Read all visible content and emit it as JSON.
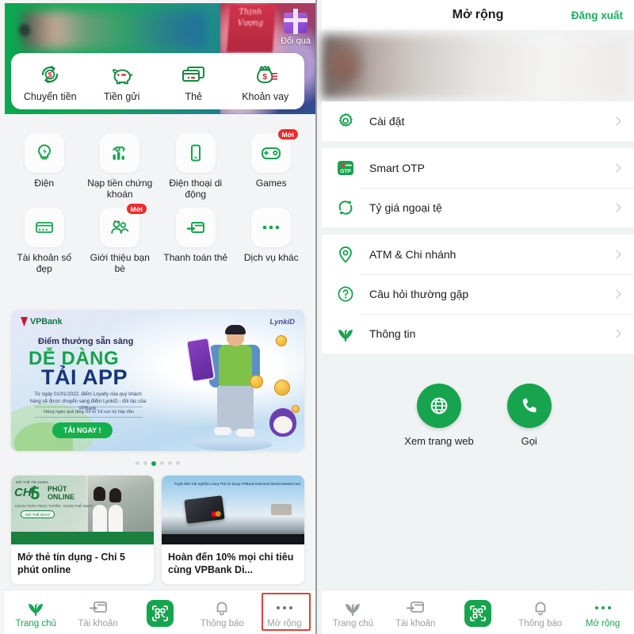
{
  "left_screen": {
    "hero": {
      "gift_label": "Đổi quà",
      "ribbon_text": "Thịnh Vượng"
    },
    "quick_actions": [
      {
        "label": "Chuyển tiền",
        "icon": "money-transfer-icon"
      },
      {
        "label": "Tiền gửi",
        "icon": "piggy-bank-icon"
      },
      {
        "label": "Thẻ",
        "icon": "credit-card-icon"
      },
      {
        "label": "Khoản vay",
        "icon": "loan-money-bag-icon"
      }
    ],
    "services": [
      {
        "label": "Điện",
        "icon": "lightbulb-icon",
        "badge": ""
      },
      {
        "label": "Nạp tiền chứng khoán",
        "icon": "stock-chart-icon",
        "badge": ""
      },
      {
        "label": "Điện thoại di động",
        "icon": "mobile-phone-icon",
        "badge": ""
      },
      {
        "label": "Games",
        "icon": "gamepad-icon",
        "badge": "Mới"
      },
      {
        "label": "Tài khoản số đẹp",
        "icon": "vip-account-card-icon",
        "badge": ""
      },
      {
        "label": "Giới thiệu bạn bè",
        "icon": "refer-friends-icon",
        "badge": "Mới"
      },
      {
        "label": "Thanh toán thẻ",
        "icon": "card-payment-icon",
        "badge": ""
      },
      {
        "label": "Dịch vụ khác",
        "icon": "more-dots-icon",
        "badge": ""
      }
    ],
    "banner": {
      "brand": "VPBank",
      "partner": "LynkiD",
      "line1": "Điểm thưởng sẵn sàng",
      "line2": "DỄ DÀNG",
      "line3": "TẢI APP",
      "paragraph": "Từ ngày 01/01/2022, điểm Loyalty của quý khách hàng sẽ được chuyển sang điểm LynkiD - đối tác của VPBank.",
      "subnote": "Hàng ngàn quà tặng chỉ từ 1đ cực kỳ hấp dẫn",
      "cta": "TẢI NGAY !",
      "dots_total": 6,
      "dots_active_index": 2
    },
    "news_cards": [
      {
        "title": "Mở thẻ tín dụng - Chỉ 5 phút online",
        "image_text_small": "MỞ THẺ TÍN DỤNG",
        "image_text_chi": "CHỈ",
        "image_text_num": "5",
        "image_text_phut": "PHÚT",
        "image_text_online": "ONLINE",
        "image_text_sub": "HOÀN TOÀN TRỰC TUYẾN - NHẬN THẺ NGAY",
        "image_btn": "MỞ THẺ NGAY"
      },
      {
        "title": "Hoàn đến 10% mọi chi tiêu cùng VPBank Di...",
        "image_text_top": "Tuyệt đỉnh trải nghiệm cùng Thẻ tín dụng VPBank Diamond World MasterCard"
      }
    ],
    "bottom_nav": [
      {
        "label": "Trang chủ",
        "icon": "home-sprout-icon",
        "active": true,
        "highlighted": false
      },
      {
        "label": "Tài khoản",
        "icon": "account-card-icon",
        "active": false,
        "highlighted": false
      },
      {
        "label": "",
        "icon": "qr-scan-icon",
        "active": false,
        "highlighted": false
      },
      {
        "label": "Thông báo",
        "icon": "bell-icon",
        "active": false,
        "highlighted": false
      },
      {
        "label": "Mở rộng",
        "icon": "more-dots-icon",
        "active": false,
        "highlighted": true
      }
    ]
  },
  "right_screen": {
    "header": {
      "title": "Mở rộng",
      "logout": "Đăng xuất"
    },
    "menu_groups": [
      {
        "items": [
          {
            "label": "Cài đặt",
            "icon": "gear-icon",
            "highlighted": true
          }
        ]
      },
      {
        "items": [
          {
            "label": "Smart OTP",
            "icon": "smart-otp-icon",
            "highlighted": false
          },
          {
            "label": "Tỷ giá ngoại tệ",
            "icon": "exchange-rate-icon",
            "highlighted": false
          }
        ]
      },
      {
        "items": [
          {
            "label": "ATM & Chi nhánh",
            "icon": "location-pin-icon",
            "highlighted": false
          },
          {
            "label": "Câu hỏi thường gặp",
            "icon": "question-mark-icon",
            "highlighted": false
          },
          {
            "label": "Thông tin",
            "icon": "info-sprout-icon",
            "highlighted": false
          }
        ]
      }
    ],
    "actions": [
      {
        "label": "Xem trang web",
        "icon": "globe-icon"
      },
      {
        "label": "Gọi",
        "icon": "phone-icon"
      }
    ],
    "bottom_nav": [
      {
        "label": "Trang chủ",
        "icon": "home-sprout-icon",
        "active": false
      },
      {
        "label": "Tài khoản",
        "icon": "account-card-icon",
        "active": false
      },
      {
        "label": "",
        "icon": "qr-scan-icon",
        "active": false
      },
      {
        "label": "Thông báo",
        "icon": "bell-icon",
        "active": false
      },
      {
        "label": "Mở rộng",
        "icon": "more-dots-icon",
        "active": true
      }
    ]
  },
  "colors": {
    "brand_green": "#17a44e",
    "accent_green": "#18b15b",
    "highlight_red": "#e2403c",
    "badge_red": "#ef2b2b",
    "page_bg": "#f0f3f4"
  }
}
